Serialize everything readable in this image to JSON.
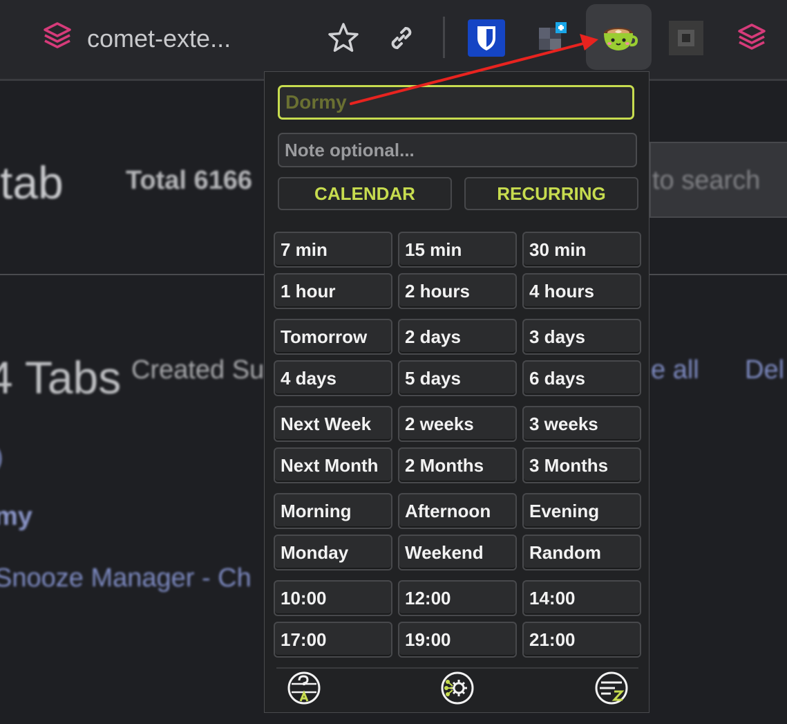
{
  "browser": {
    "tab_title": "comet-exte...",
    "icons": [
      "layers-icon",
      "star-icon",
      "link-icon",
      "bitwarden-icon",
      "extension-icon",
      "coffee-cup-icon",
      "extension-icon",
      "layers-icon"
    ]
  },
  "background": {
    "heading": "tab",
    "total": "Total 6166",
    "search_hint": "to search",
    "tabs_heading": "4 Tabs",
    "created": "Created Su",
    "select_all": "e all",
    "delete": "Del",
    "paren": ")",
    "item_name": "my",
    "item_title": "Snooze Manager - Ch"
  },
  "popup": {
    "title_placeholder": "Dormy",
    "note_placeholder": "Note optional...",
    "calendar_label": "CALENDAR",
    "recurring_label": "RECURRING",
    "options": [
      [
        "7 min",
        "15 min",
        "30 min"
      ],
      [
        "1 hour",
        "2 hours",
        "4 hours"
      ],
      [
        "Tomorrow",
        "2 days",
        "3 days"
      ],
      [
        "4 days",
        "5 days",
        "6 days"
      ],
      [
        "Next Week",
        "2 weeks",
        "3 weeks"
      ],
      [
        "Next Month",
        "2 Months",
        "3 Months"
      ],
      [
        "Morning",
        "Afternoon",
        "Evening"
      ],
      [
        "Monday",
        "Weekend",
        "Random"
      ],
      [
        "10:00",
        "12:00",
        "14:00"
      ],
      [
        "17:00",
        "19:00",
        "21:00"
      ]
    ],
    "footer_icons": [
      "help-translate-icon",
      "settings-icon",
      "snooze-list-icon"
    ]
  },
  "colors": {
    "accent": "#c7dc4f",
    "annotation": "#e8231f",
    "layers_pink": "#d63b7a"
  }
}
